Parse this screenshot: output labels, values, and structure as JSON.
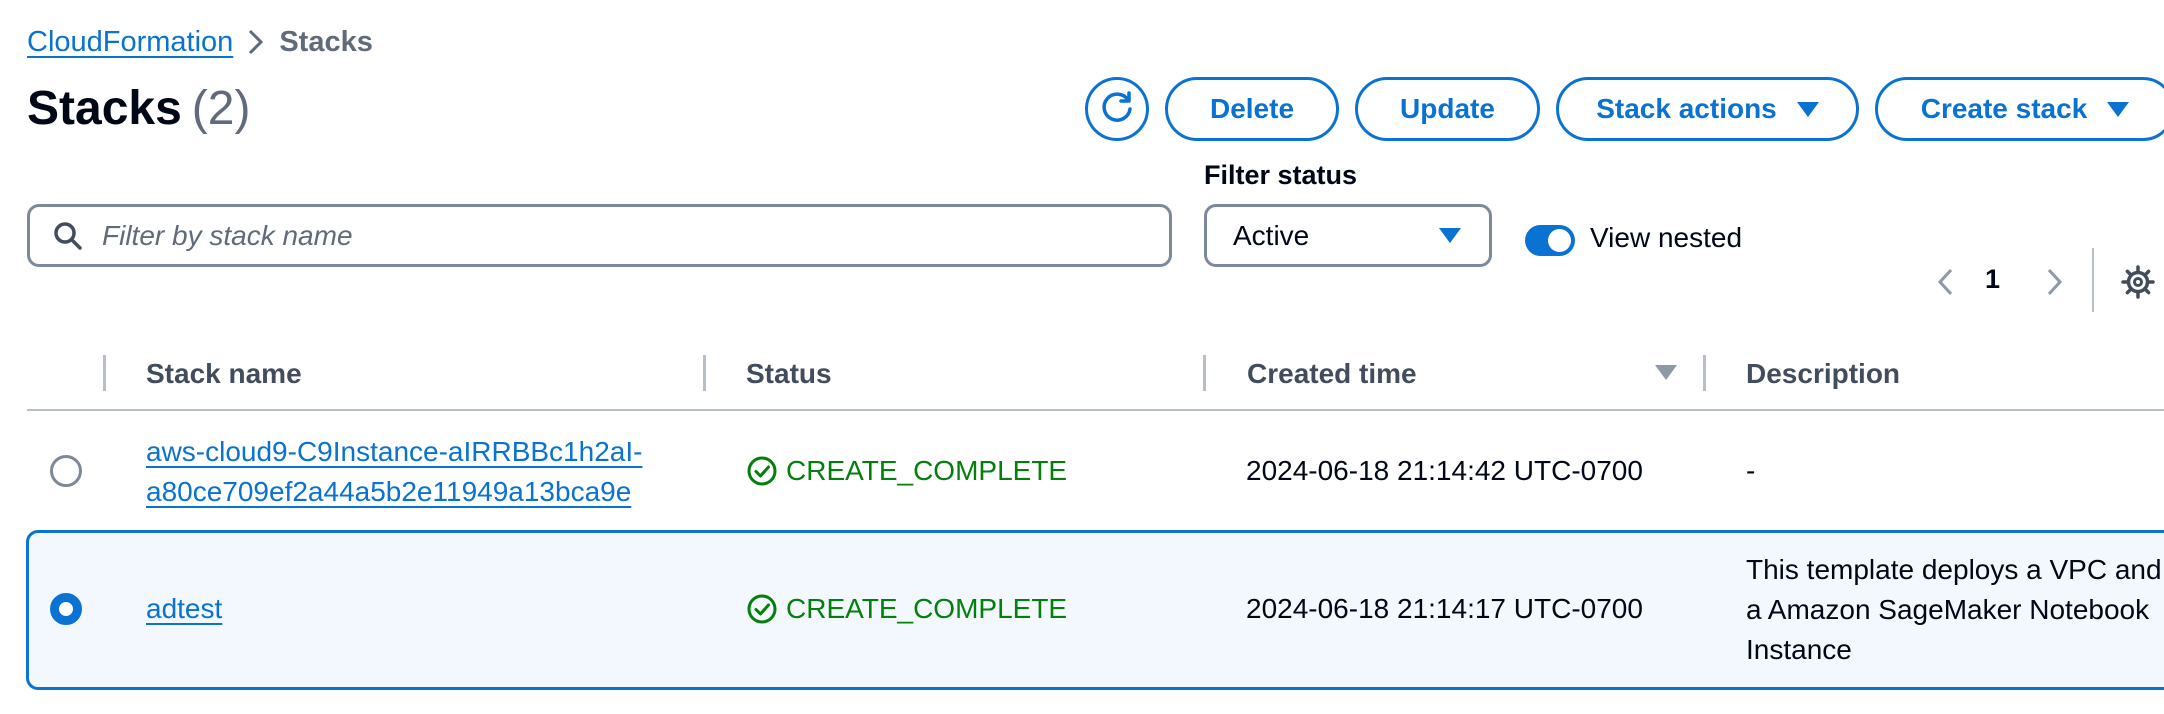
{
  "breadcrumb": {
    "root": "CloudFormation",
    "current": "Stacks"
  },
  "header": {
    "title": "Stacks",
    "count": "(2)"
  },
  "toolbar": {
    "delete_label": "Delete",
    "update_label": "Update",
    "stack_actions_label": "Stack actions",
    "create_stack_label": "Create stack"
  },
  "filters": {
    "search_placeholder": "Filter by stack name",
    "status_label": "Filter status",
    "status_value": "Active",
    "view_nested_label": "View nested",
    "view_nested_on": true
  },
  "pagination": {
    "current_page": "1"
  },
  "table": {
    "columns": [
      "Stack name",
      "Status",
      "Created time",
      "Description"
    ],
    "rows": [
      {
        "name_line1": "aws-cloud9-C9Instance-aIRRBBc1h2aI-",
        "name_line2": "a80ce709ef2a44a5b2e11949a13bca9e",
        "status": "CREATE_COMPLETE",
        "created": "2024-06-18 21:14:42 UTC-0700",
        "description": "-",
        "selected": false
      },
      {
        "name": "adtest",
        "status": "CREATE_COMPLETE",
        "created": "2024-06-18 21:14:17 UTC-0700",
        "description_line1": "This template deploys a VPC and",
        "description_line2": "a Amazon SageMaker Notebook",
        "description_line3": "Instance",
        "selected": true
      }
    ]
  },
  "colors": {
    "accent": "#0972d3",
    "success": "#037f0c",
    "text": "#000716",
    "muted": "#5f6b7a"
  }
}
